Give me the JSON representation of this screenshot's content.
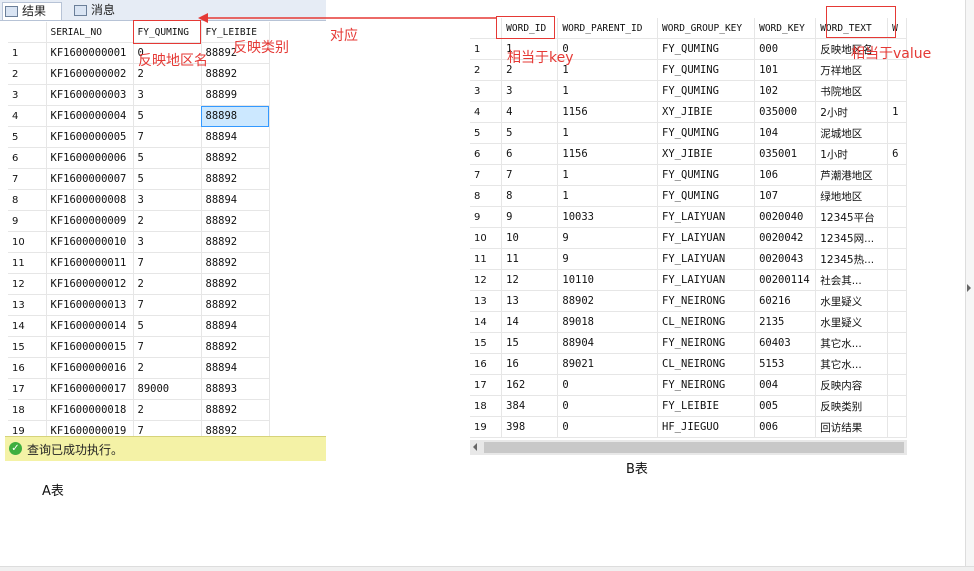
{
  "tabs": [
    {
      "label": "结果"
    },
    {
      "label": "消息"
    }
  ],
  "tableA": {
    "columns": [
      "SERIAL_NO",
      "FY_QUMING",
      "FY_LEIBIE"
    ],
    "rows": [
      [
        "1",
        "KF1600000001",
        "0",
        "88892"
      ],
      [
        "2",
        "KF1600000002",
        "2",
        "88892"
      ],
      [
        "3",
        "KF1600000003",
        "3",
        "88899"
      ],
      [
        "4",
        "KF1600000004",
        "5",
        "88898"
      ],
      [
        "5",
        "KF1600000005",
        "7",
        "88894"
      ],
      [
        "6",
        "KF1600000006",
        "5",
        "88892"
      ],
      [
        "7",
        "KF1600000007",
        "5",
        "88892"
      ],
      [
        "8",
        "KF1600000008",
        "3",
        "88894"
      ],
      [
        "9",
        "KF1600000009",
        "2",
        "88892"
      ],
      [
        "10",
        "KF1600000010",
        "3",
        "88892"
      ],
      [
        "11",
        "KF1600000011",
        "7",
        "88892"
      ],
      [
        "12",
        "KF1600000012",
        "2",
        "88892"
      ],
      [
        "13",
        "KF1600000013",
        "7",
        "88892"
      ],
      [
        "14",
        "KF1600000014",
        "5",
        "88894"
      ],
      [
        "15",
        "KF1600000015",
        "7",
        "88892"
      ],
      [
        "16",
        "KF1600000016",
        "2",
        "88894"
      ],
      [
        "17",
        "KF1600000017",
        "89000",
        "88893"
      ],
      [
        "18",
        "KF1600000018",
        "2",
        "88892"
      ],
      [
        "19",
        "KF1600000019",
        "7",
        "88892"
      ]
    ],
    "selected_row": 3
  },
  "status": {
    "text": "查询已成功执行。"
  },
  "labelA": "A表",
  "tableB": {
    "columns": [
      "WORD_ID",
      "WORD_PARENT_ID",
      "WORD_GROUP_KEY",
      "WORD_KEY",
      "WORD_TEXT",
      "W"
    ],
    "rows": [
      [
        "1",
        "1",
        "0",
        "FY_QUMING",
        "000",
        "反映地区名",
        ""
      ],
      [
        "2",
        "2",
        "1",
        "FY_QUMING",
        "101",
        "万祥地区",
        ""
      ],
      [
        "3",
        "3",
        "1",
        "FY_QUMING",
        "102",
        "书院地区",
        ""
      ],
      [
        "4",
        "4",
        "1156",
        "XY_JIBIE",
        "035000",
        "2小时",
        "1"
      ],
      [
        "5",
        "5",
        "1",
        "FY_QUMING",
        "104",
        "泥城地区",
        ""
      ],
      [
        "6",
        "6",
        "1156",
        "XY_JIBIE",
        "035001",
        "1小时",
        "6"
      ],
      [
        "7",
        "7",
        "1",
        "FY_QUMING",
        "106",
        "芦潮港地区",
        ""
      ],
      [
        "8",
        "8",
        "1",
        "FY_QUMING",
        "107",
        "绿地地区",
        ""
      ],
      [
        "9",
        "9",
        "10033",
        "FY_LAIYUAN",
        "0020040",
        "12345平台",
        ""
      ],
      [
        "10",
        "10",
        "9",
        "FY_LAIYUAN",
        "0020042",
        "12345网...",
        ""
      ],
      [
        "11",
        "11",
        "9",
        "FY_LAIYUAN",
        "0020043",
        "12345热...",
        ""
      ],
      [
        "12",
        "12",
        "10110",
        "FY_LAIYUAN",
        "00200114",
        "社会其...",
        ""
      ],
      [
        "13",
        "13",
        "88902",
        "FY_NEIRONG",
        "60216",
        "水里疑义",
        ""
      ],
      [
        "14",
        "14",
        "89018",
        "CL_NEIRONG",
        "2135",
        "水里疑义",
        ""
      ],
      [
        "15",
        "15",
        "88904",
        "FY_NEIRONG",
        "60403",
        "其它水...",
        ""
      ],
      [
        "16",
        "16",
        "89021",
        "CL_NEIRONG",
        "5153",
        "其它水...",
        ""
      ],
      [
        "17",
        "162",
        "0",
        "FY_NEIRONG",
        "004",
        "反映内容",
        ""
      ],
      [
        "18",
        "384",
        "0",
        "FY_LEIBIE",
        "005",
        "反映类别",
        ""
      ],
      [
        "19",
        "398",
        "0",
        "HF_JIEGUO",
        "006",
        "回访结果",
        ""
      ]
    ]
  },
  "labelB": "B表",
  "annotations": {
    "quming_label": "反映地区名",
    "leibie_label": "反映类别",
    "duiying": "对应",
    "key_label": "相当于key",
    "value_label": "相当于value"
  },
  "colors": {
    "annotation": "#e53935",
    "status_bg": "#f4f2a6",
    "selection": "#cce8ff"
  }
}
